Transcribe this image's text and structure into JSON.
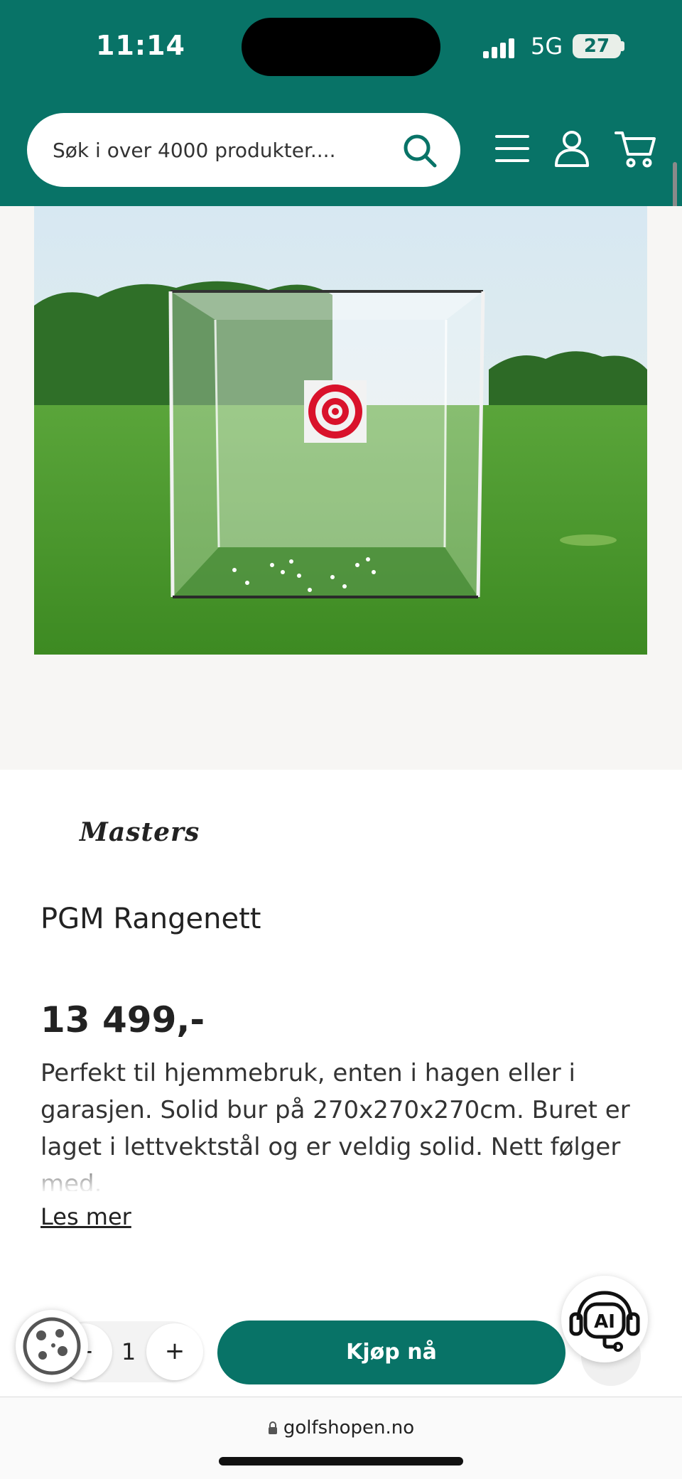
{
  "status_bar": {
    "time": "11:14",
    "network": "5G",
    "battery": "27"
  },
  "header": {
    "search_placeholder": "Søk i over 4000 produkter...."
  },
  "product": {
    "brand": "Masters",
    "title": "PGM Rangenett",
    "price": "13 499,-",
    "description": "Perfekt til hjemmebruk, enten i hagen eller i garasjen. Solid bur på 270x270x270cm. Buret er laget i lettvektstål og er veldig solid. Nett følger med.",
    "read_more": "Les mer"
  },
  "cart_bar": {
    "quantity": "1",
    "minus": "−",
    "plus": "+",
    "buy_label": "Kjøp nå"
  },
  "browser": {
    "url": "golfshopen.no"
  },
  "colors": {
    "brand_green": "#087367"
  }
}
